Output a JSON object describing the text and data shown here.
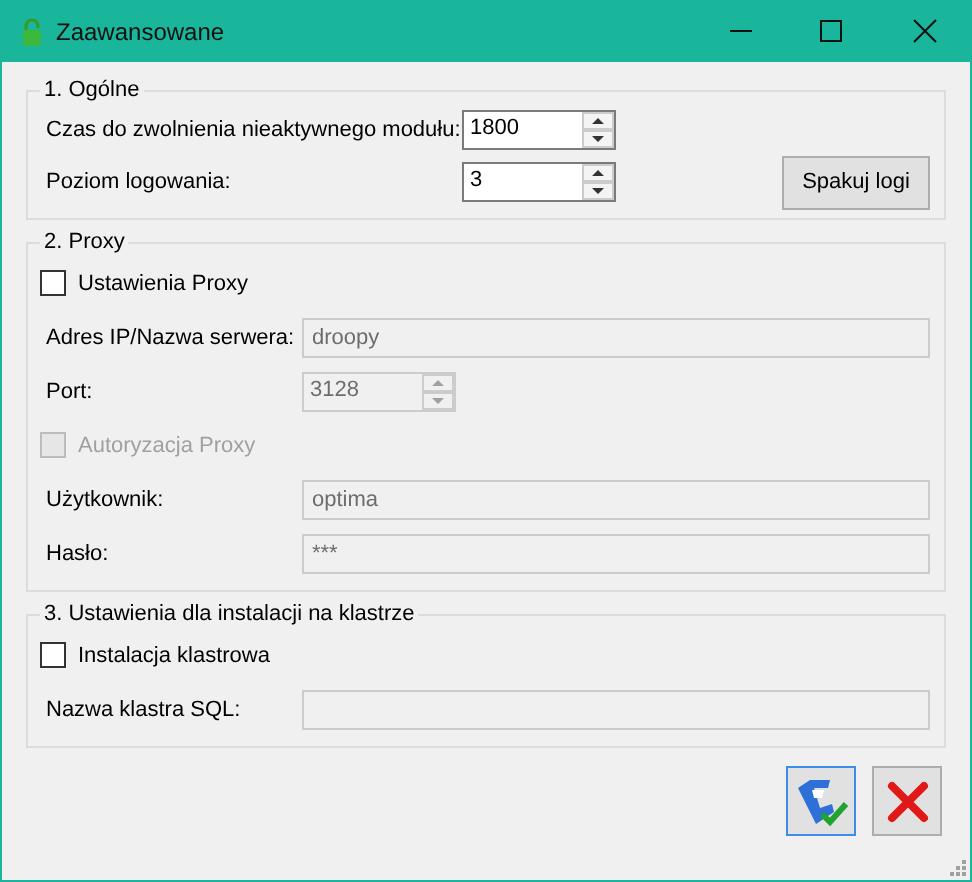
{
  "window": {
    "title": "Zaawansowane"
  },
  "sections": [
    {
      "title": "1. Ogólne",
      "button": "Spakuj logi",
      "items": [
        {
          "kind": "spinner",
          "label": "Czas do zwolnienia nieaktywnego modułu:",
          "value": "1800",
          "disabled": false
        },
        {
          "kind": "spinner",
          "label": "Poziom logowania:",
          "value": "3",
          "disabled": false
        }
      ]
    },
    {
      "title": "2. Proxy",
      "items": [
        {
          "kind": "checkbox",
          "label": "Ustawienia Proxy",
          "checked": false,
          "disabled": false
        },
        {
          "kind": "text",
          "label": "Adres IP/Nazwa serwera:",
          "value": "droopy",
          "disabled": true
        },
        {
          "kind": "spinner",
          "label": "Port:",
          "value": "3128",
          "disabled": true
        },
        {
          "kind": "checkbox",
          "label": "Autoryzacja Proxy",
          "checked": false,
          "disabled": true
        },
        {
          "kind": "text",
          "label": "Użytkownik:",
          "value": "optima",
          "disabled": true
        },
        {
          "kind": "text",
          "label": "Hasło:",
          "value": "***",
          "disabled": true
        }
      ]
    },
    {
      "title": "3. Ustawienia dla instalacji na klastrze",
      "items": [
        {
          "kind": "checkbox",
          "label": "Instalacja klastrowa",
          "checked": false,
          "disabled": false
        },
        {
          "kind": "text",
          "label": "Nazwa klastra SQL:",
          "disabled": true
        }
      ]
    }
  ]
}
